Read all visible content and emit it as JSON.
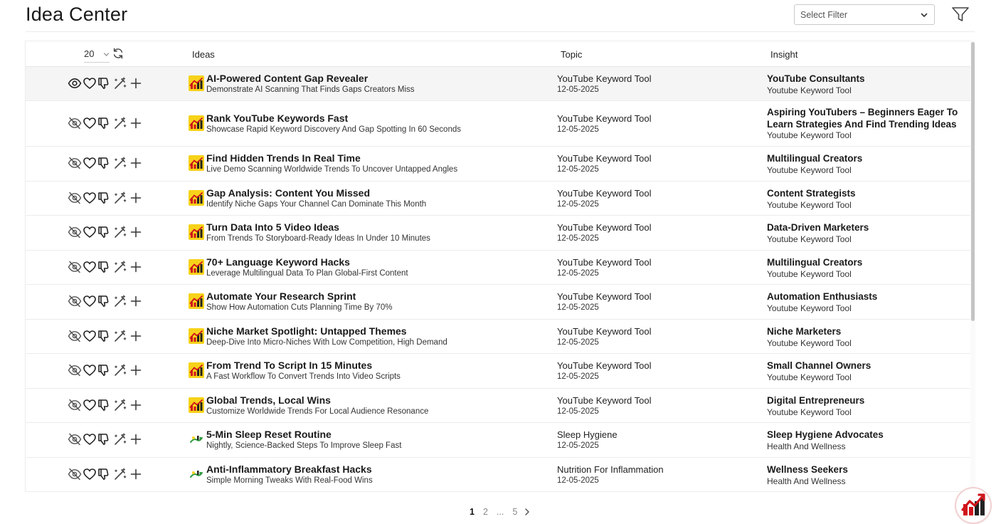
{
  "header": {
    "title": "Idea Center",
    "filter_placeholder": "Select Filter"
  },
  "table": {
    "page_size": "20",
    "columns": [
      "Ideas",
      "Topic",
      "Insight"
    ],
    "rows": [
      {
        "title": "AI-Powered Content Gap Revealer",
        "subtitle": "Demonstrate AI Scanning That Finds Gaps Creators Miss",
        "topic": "YouTube Keyword Tool",
        "date": "12-05-2025",
        "insight": "YouTube Consultants",
        "insight_sub": "Youtube Keyword Tool",
        "logo": "keyword-tool-logo-icon",
        "visible": true
      },
      {
        "title": "Rank YouTube Keywords Fast",
        "subtitle": "Showcase Rapid Keyword Discovery And Gap Spotting In 60 Seconds",
        "topic": "YouTube Keyword Tool",
        "date": "12-05-2025",
        "insight": "Aspiring YouTubers – Beginners Eager To Learn Strategies And Find Trending Ideas",
        "insight_sub": "Youtube Keyword Tool",
        "logo": "keyword-tool-logo-icon",
        "visible": false
      },
      {
        "title": "Find Hidden Trends In Real Time",
        "subtitle": "Live Demo Scanning Worldwide Trends To Uncover Untapped Angles",
        "topic": "YouTube Keyword Tool",
        "date": "12-05-2025",
        "insight": "Multilingual Creators",
        "insight_sub": "Youtube Keyword Tool",
        "logo": "keyword-tool-logo-icon",
        "visible": false
      },
      {
        "title": "Gap Analysis: Content You Missed",
        "subtitle": "Identify Niche Gaps Your Channel Can Dominate This Month",
        "topic": "YouTube Keyword Tool",
        "date": "12-05-2025",
        "insight": "Content Strategists",
        "insight_sub": "Youtube Keyword Tool",
        "logo": "keyword-tool-logo-icon",
        "visible": false
      },
      {
        "title": "Turn Data Into 5 Video Ideas",
        "subtitle": "From Trends To Storyboard-Ready Ideas In Under 10 Minutes",
        "topic": "YouTube Keyword Tool",
        "date": "12-05-2025",
        "insight": "Data-Driven Marketers",
        "insight_sub": "Youtube Keyword Tool",
        "logo": "keyword-tool-logo-icon",
        "visible": false
      },
      {
        "title": "70+ Language Keyword Hacks",
        "subtitle": "Leverage Multilingual Data To Plan Global-First Content",
        "topic": "YouTube Keyword Tool",
        "date": "12-05-2025",
        "insight": "Multilingual Creators",
        "insight_sub": "Youtube Keyword Tool",
        "logo": "keyword-tool-logo-icon",
        "visible": false
      },
      {
        "title": "Automate Your Research Sprint",
        "subtitle": "Show How Automation Cuts Planning Time By 70%",
        "topic": "YouTube Keyword Tool",
        "date": "12-05-2025",
        "insight": "Automation Enthusiasts",
        "insight_sub": "Youtube Keyword Tool",
        "logo": "keyword-tool-logo-icon",
        "visible": false
      },
      {
        "title": "Niche Market Spotlight: Untapped Themes",
        "subtitle": "Deep-Dive Into Micro-Niches With Low Competition, High Demand",
        "topic": "YouTube Keyword Tool",
        "date": "12-05-2025",
        "insight": "Niche Marketers",
        "insight_sub": "Youtube Keyword Tool",
        "logo": "keyword-tool-logo-icon",
        "visible": false
      },
      {
        "title": "From Trend To Script In 15 Minutes",
        "subtitle": "A Fast Workflow To Convert Trends Into Video Scripts",
        "topic": "YouTube Keyword Tool",
        "date": "12-05-2025",
        "insight": "Small Channel Owners",
        "insight_sub": "Youtube Keyword Tool",
        "logo": "keyword-tool-logo-icon",
        "visible": false
      },
      {
        "title": "Global Trends, Local Wins",
        "subtitle": "Customize Worldwide Trends For Local Audience Resonance",
        "topic": "YouTube Keyword Tool",
        "date": "12-05-2025",
        "insight": "Digital Entrepreneurs",
        "insight_sub": "Youtube Keyword Tool",
        "logo": "keyword-tool-logo-icon",
        "visible": false
      },
      {
        "title": "5-Min Sleep Reset Routine",
        "subtitle": "Nightly, Science-Backed Steps To Improve Sleep Fast",
        "topic": "Sleep Hygiene",
        "date": "12-05-2025",
        "insight": "Sleep Hygiene Advocates",
        "insight_sub": "Health And Wellness",
        "logo": "health-wellness-logo-icon",
        "visible": false
      },
      {
        "title": "Anti-Inflammatory Breakfast Hacks",
        "subtitle": "Simple Morning Tweaks With Real-Food Wins",
        "topic": "Nutrition For Inflammation",
        "date": "12-05-2025",
        "insight": "Wellness Seekers",
        "insight_sub": "Health And Wellness",
        "logo": "health-wellness-logo-icon",
        "visible": false
      }
    ]
  },
  "pagination": {
    "pages": [
      "1",
      "2",
      "...",
      "5"
    ],
    "current": "1"
  },
  "colors": {
    "brand_red": "#d0141b",
    "brand_yellow": "#f7d21a",
    "icon_dark": "#333333",
    "row_highlight": "#f5f5f5"
  },
  "icons": {
    "row_actions": [
      "eye-icon",
      "heart-icon",
      "thumbs-down-icon",
      "magic-wand-icon",
      "plus-icon"
    ],
    "header": [
      "chevron-down-icon",
      "filter-icon",
      "refresh-icon"
    ],
    "floating": "brand-logo-icon"
  }
}
